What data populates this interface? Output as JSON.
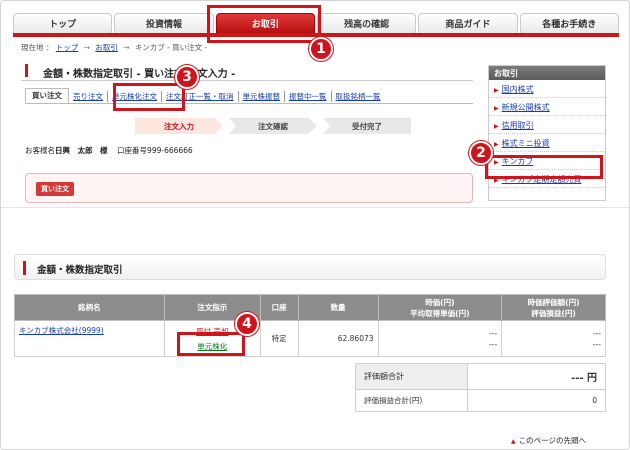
{
  "tabs": [
    {
      "label": "トップ"
    },
    {
      "label": "投資情報"
    },
    {
      "label": "お取引"
    },
    {
      "label": "残高の確認"
    },
    {
      "label": "商品ガイド"
    },
    {
      "label": "各種お手続き"
    }
  ],
  "breadcrumb": {
    "prefix": "現在地 ：",
    "items": [
      "トップ",
      "お取引",
      "キンカブ - 買い注文 -"
    ]
  },
  "page": {
    "title": "金額・株数指定取引 - 買い注文 注文入力 -",
    "subtabs": [
      "買い注文",
      "売り注文",
      "単元株化注文",
      "注文訂正一覧・取消",
      "単元株振替",
      "振替中一覧",
      "取扱銘柄一覧"
    ],
    "steps": [
      "注文入力",
      "注文確認",
      "受付完了"
    ],
    "customer_label": "お客様名",
    "customer_name": "日興　太郎　様",
    "account_label": "口座番号",
    "account_number": "999-666666",
    "buy_label": "買い注文"
  },
  "side_menu": {
    "title": "お取引",
    "items": [
      "国内株式",
      "新規公開株式",
      "信用取引",
      "株式ミニ投資",
      "キンカブ",
      "キンカブ定期定額売買"
    ]
  },
  "callouts": [
    "1",
    "2",
    "3",
    "4"
  ],
  "section": {
    "title": "金額・株数指定取引"
  },
  "table": {
    "headers": {
      "name": "銘柄名",
      "order": "注文指示",
      "account": "口座",
      "quantity": "数量",
      "price_line1": "時価(円)",
      "price_line2": "平均取得単価(円)",
      "value_line1": "時価評価額(円)",
      "value_line2": "評価損益(円)"
    },
    "rows": [
      {
        "name": "キンカブ株式会社(9999)",
        "order_buysell": "買付 売却",
        "order_convert": "単元株化",
        "account": "特定",
        "quantity": "62.86073",
        "price": "---",
        "avg_price": "---",
        "value": "---",
        "pnl": "---"
      }
    ]
  },
  "summary": {
    "total_label": "評価額合計",
    "total_value": "--- 円",
    "pnl_label": "評価損益合計(円)",
    "pnl_value": "0"
  },
  "footer": {
    "to_top": "このページの先頭へ"
  },
  "colors": {
    "accent": "#c81818",
    "highlight": "#d0141c",
    "link": "#1a3ea8",
    "convert_link": "#0a7a1e"
  }
}
